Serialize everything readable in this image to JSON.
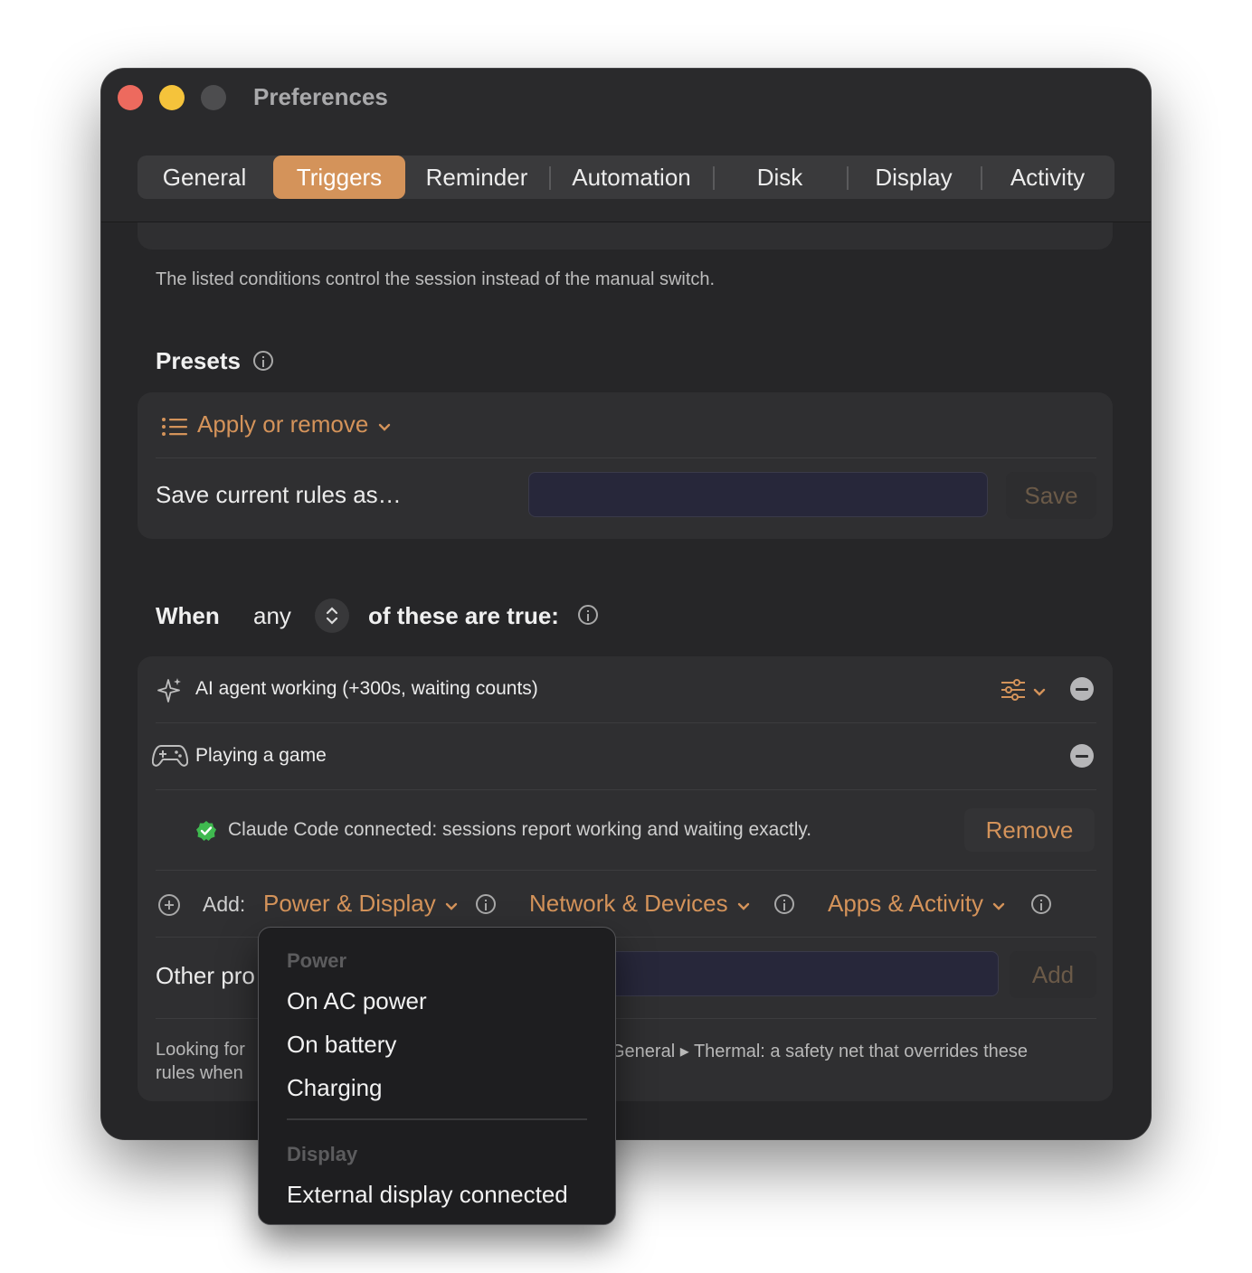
{
  "window": {
    "title": "Preferences"
  },
  "tabs": [
    {
      "label": "General"
    },
    {
      "label": "Triggers",
      "selected": true
    },
    {
      "label": "Reminder"
    },
    {
      "label": "Automation"
    },
    {
      "label": "Disk"
    },
    {
      "label": "Display"
    },
    {
      "label": "Activity"
    }
  ],
  "intro": {
    "description": "The listed conditions control the session instead of the manual switch."
  },
  "presets": {
    "heading": "Presets",
    "apply_label": "Apply or remove",
    "save_label": "Save current rules as…",
    "name_value": "",
    "save_button": "Save"
  },
  "rules": {
    "when_label": "When",
    "mode_value": "any",
    "suffix_label": "of these are true:",
    "items": [
      {
        "label": "AI agent working (+300s, waiting counts)",
        "icon": "sparkle-icon"
      },
      {
        "label": "Playing a game",
        "icon": "gamepad-icon"
      }
    ],
    "status_text": "Claude Code connected: sessions report working and waiting exactly.",
    "remove_button": "Remove",
    "add_label": "Add:",
    "add_menus": [
      {
        "label": "Power & Display"
      },
      {
        "label": "Network & Devices"
      },
      {
        "label": "Apps & Activity"
      }
    ],
    "other_label": "Other pro",
    "other_value": "",
    "other_add_button": "Add",
    "footer_line1_left": "Looking for",
    "footer_line1_right": "General ▸ Thermal: a safety net that overrides these",
    "footer_line2_left": "rules when"
  },
  "dropdown": {
    "sections": [
      {
        "header": "Power",
        "items": [
          "On AC power",
          "On battery",
          "Charging"
        ]
      },
      {
        "header": "Display",
        "items": [
          "External display connected"
        ]
      }
    ]
  },
  "colors": {
    "accent": "#d4935a",
    "window_bg": "#2a2a2c",
    "card_bg": "#2f2f31",
    "success": "#3fb94f"
  }
}
